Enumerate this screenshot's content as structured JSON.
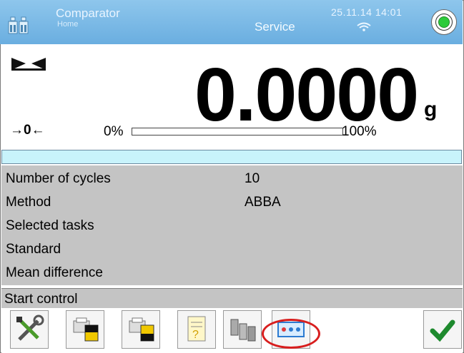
{
  "header": {
    "app_title": "Comparator",
    "app_subtitle": "Home",
    "mode": "Service",
    "datetime": "25.11.14 14:01",
    "status_icon": "status-indicator-icon"
  },
  "display": {
    "weight": "0.0000",
    "unit": "g",
    "zero_indicator": "→0←",
    "bar_min_label": "0%",
    "bar_max_label": "100%",
    "bar_fill_fraction": 0
  },
  "info": {
    "rows": [
      {
        "label": "Number of cycles",
        "value": "10"
      },
      {
        "label": "Method",
        "value": "ABBA"
      },
      {
        "label": "Selected tasks",
        "value": ""
      },
      {
        "label": "Standard",
        "value": ""
      },
      {
        "label": "Mean difference",
        "value": ""
      }
    ]
  },
  "actions": {
    "start_control": "Start control"
  },
  "toolbar": {
    "buttons": [
      "settings-icon",
      "print-header-icon",
      "print-footer-icon",
      "report-icon",
      "weights-icon",
      "task-selection-icon",
      "confirm-icon"
    ]
  }
}
